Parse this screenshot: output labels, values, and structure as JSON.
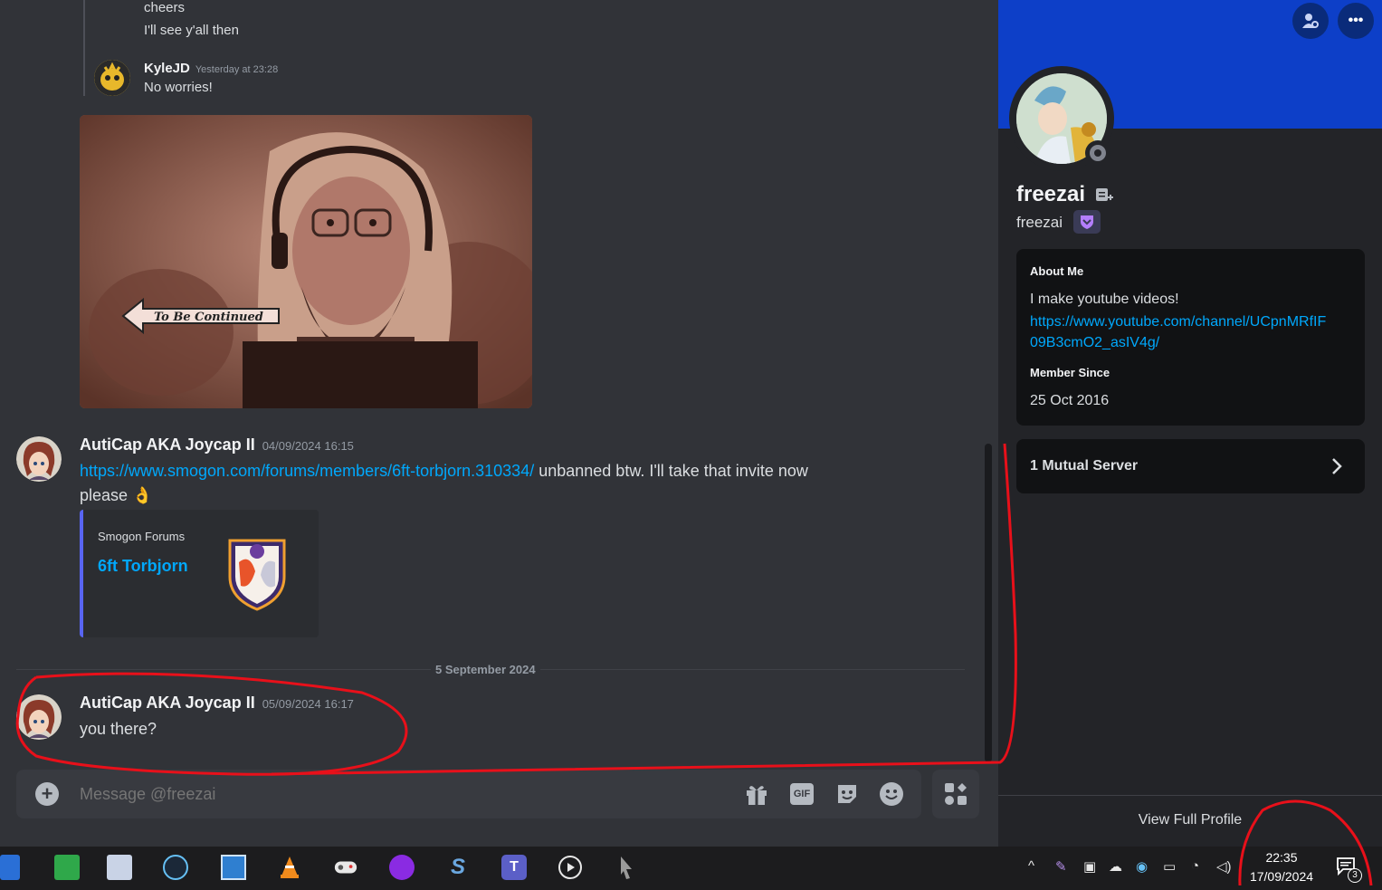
{
  "chat": {
    "prev": {
      "line1": "cheers",
      "line2": "I'll see y'all then"
    },
    "kyle": {
      "username": "KyleJD",
      "timestamp": "Yesterday at 23:28",
      "text": "No worries!"
    },
    "image": {
      "caption": "To Be Continued"
    },
    "msg1": {
      "username": "AutiCap AKA Joycap II",
      "timestamp": "04/09/2024 16:15",
      "link": "https://www.smogon.com/forums/members/6ft-torbjorn.310334/",
      "text_after": " unbanned btw. I'll take that invite now",
      "text_line2": "please",
      "emoji": "👌"
    },
    "embed": {
      "provider": "Smogon Forums",
      "title": "6ft Torbjorn"
    },
    "divider": "5 September 2024",
    "msg2": {
      "username": "AutiCap AKA Joycap II",
      "timestamp": "05/09/2024 16:17",
      "text": "you there?"
    },
    "input": {
      "placeholder": "Message @freezai"
    },
    "gif_label": "GIF"
  },
  "profile": {
    "display_name": "freezai",
    "username": "freezai",
    "about_heading": "About Me",
    "about_text": "I make youtube videos!",
    "about_link_line1": "https://www.youtube.com/channel/UCpnMRfIF",
    "about_link_line2": "09B3cmO2_asIV4g/",
    "member_since_heading": "Member Since",
    "member_since": "25 Oct 2016",
    "mutual_servers": "1 Mutual Server",
    "view_full_profile": "View Full Profile",
    "banner_color": "#0d3fc8"
  },
  "taskbar": {
    "time": "22:35",
    "date": "17/09/2024",
    "notification_count": "3"
  }
}
